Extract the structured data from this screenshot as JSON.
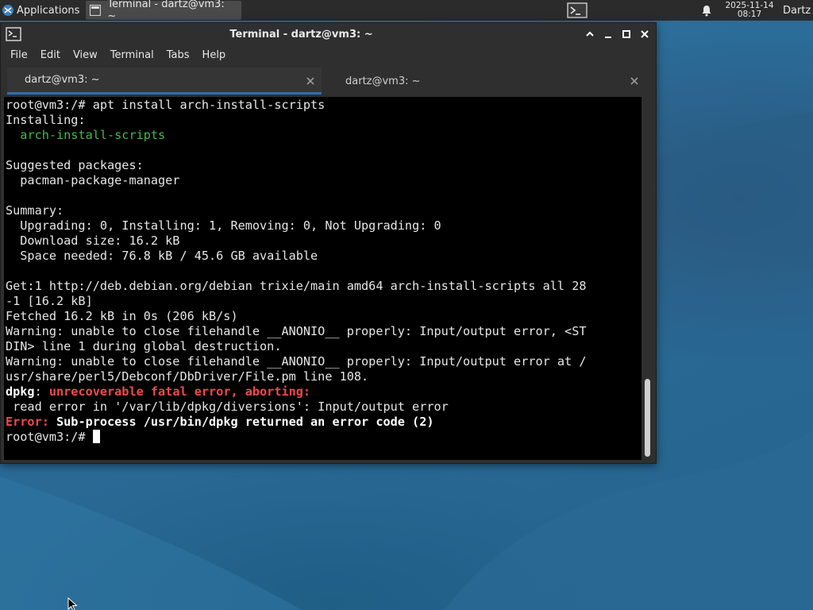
{
  "panel": {
    "applications_label": "Applications",
    "task_label": "Terminal - dartz@vm3: ~",
    "clock_date": "2025-11-14",
    "clock_time": "08:17",
    "user_label": "Dartz",
    "icons": {
      "apps": "xfce-mouse-icon",
      "task": "terminal-icon",
      "launcher": "terminal-prompt-icon",
      "notifications": "bell-icon"
    }
  },
  "window": {
    "title": "Terminal - dartz@vm3: ~",
    "menu": [
      "File",
      "Edit",
      "View",
      "Terminal",
      "Tabs",
      "Help"
    ],
    "tabs": [
      {
        "label": "dartz@vm3: ~",
        "active": true
      },
      {
        "label": "dartz@vm3: ~",
        "active": false
      }
    ]
  },
  "terminal": {
    "lines": [
      {
        "segments": [
          {
            "text": "root@vm3:/# apt install arch-install-scripts",
            "style": "normal"
          }
        ]
      },
      {
        "segments": [
          {
            "text": "Installing:",
            "style": "normal"
          }
        ]
      },
      {
        "segments": [
          {
            "text": "  ",
            "style": "normal"
          },
          {
            "text": "arch-install-scripts",
            "style": "green"
          }
        ]
      },
      {
        "segments": [
          {
            "text": "",
            "style": "normal"
          }
        ]
      },
      {
        "segments": [
          {
            "text": "Suggested packages:",
            "style": "normal"
          }
        ]
      },
      {
        "segments": [
          {
            "text": "  pacman-package-manager",
            "style": "normal"
          }
        ]
      },
      {
        "segments": [
          {
            "text": "",
            "style": "normal"
          }
        ]
      },
      {
        "segments": [
          {
            "text": "Summary:",
            "style": "normal"
          }
        ]
      },
      {
        "segments": [
          {
            "text": "  Upgrading: 0, Installing: 1, Removing: 0, Not Upgrading: 0",
            "style": "normal"
          }
        ]
      },
      {
        "segments": [
          {
            "text": "  Download size: 16.2 kB",
            "style": "normal"
          }
        ]
      },
      {
        "segments": [
          {
            "text": "  Space needed: 76.8 kB / 45.6 GB available",
            "style": "normal"
          }
        ]
      },
      {
        "segments": [
          {
            "text": "",
            "style": "normal"
          }
        ]
      },
      {
        "segments": [
          {
            "text": "Get:1 http://deb.debian.org/debian trixie/main amd64 arch-install-scripts all 28",
            "style": "normal"
          }
        ]
      },
      {
        "segments": [
          {
            "text": "-1 [16.2 kB]",
            "style": "normal"
          }
        ]
      },
      {
        "segments": [
          {
            "text": "Fetched 16.2 kB in 0s (206 kB/s)",
            "style": "normal"
          }
        ]
      },
      {
        "segments": [
          {
            "text": "Warning: unable to close filehandle __ANONIO__ properly: Input/output error, <ST",
            "style": "normal"
          }
        ]
      },
      {
        "segments": [
          {
            "text": "DIN> line 1 during global destruction.",
            "style": "normal"
          }
        ]
      },
      {
        "segments": [
          {
            "text": "Warning: unable to close filehandle __ANONIO__ properly: Input/output error at /",
            "style": "normal"
          }
        ]
      },
      {
        "segments": [
          {
            "text": "usr/share/perl5/Debconf/DbDriver/File.pm line 108.",
            "style": "normal"
          }
        ]
      },
      {
        "segments": [
          {
            "text": "dpkg",
            "style": "bold"
          },
          {
            "text": ": ",
            "style": "normal"
          },
          {
            "text": "unrecoverable fatal error, aborting:",
            "style": "red"
          }
        ]
      },
      {
        "segments": [
          {
            "text": " read error in '/var/lib/dpkg/diversions': Input/output error",
            "style": "normal"
          }
        ]
      },
      {
        "segments": [
          {
            "text": "Error: ",
            "style": "red"
          },
          {
            "text": "Sub-process /usr/bin/dpkg returned an error code (2)",
            "style": "bold"
          }
        ]
      },
      {
        "segments": [
          {
            "text": "root@vm3:/# ",
            "style": "normal"
          }
        ],
        "cursor": true
      }
    ]
  },
  "colors": {
    "panel_bg": "#2b2b2b",
    "window_bg": "#2f2f2f",
    "terminal_bg": "#000000",
    "green": "#3fbd45",
    "red": "#f04a4a",
    "tab_accent": "#2a6fb8",
    "desktop": "#2d6e9a"
  }
}
